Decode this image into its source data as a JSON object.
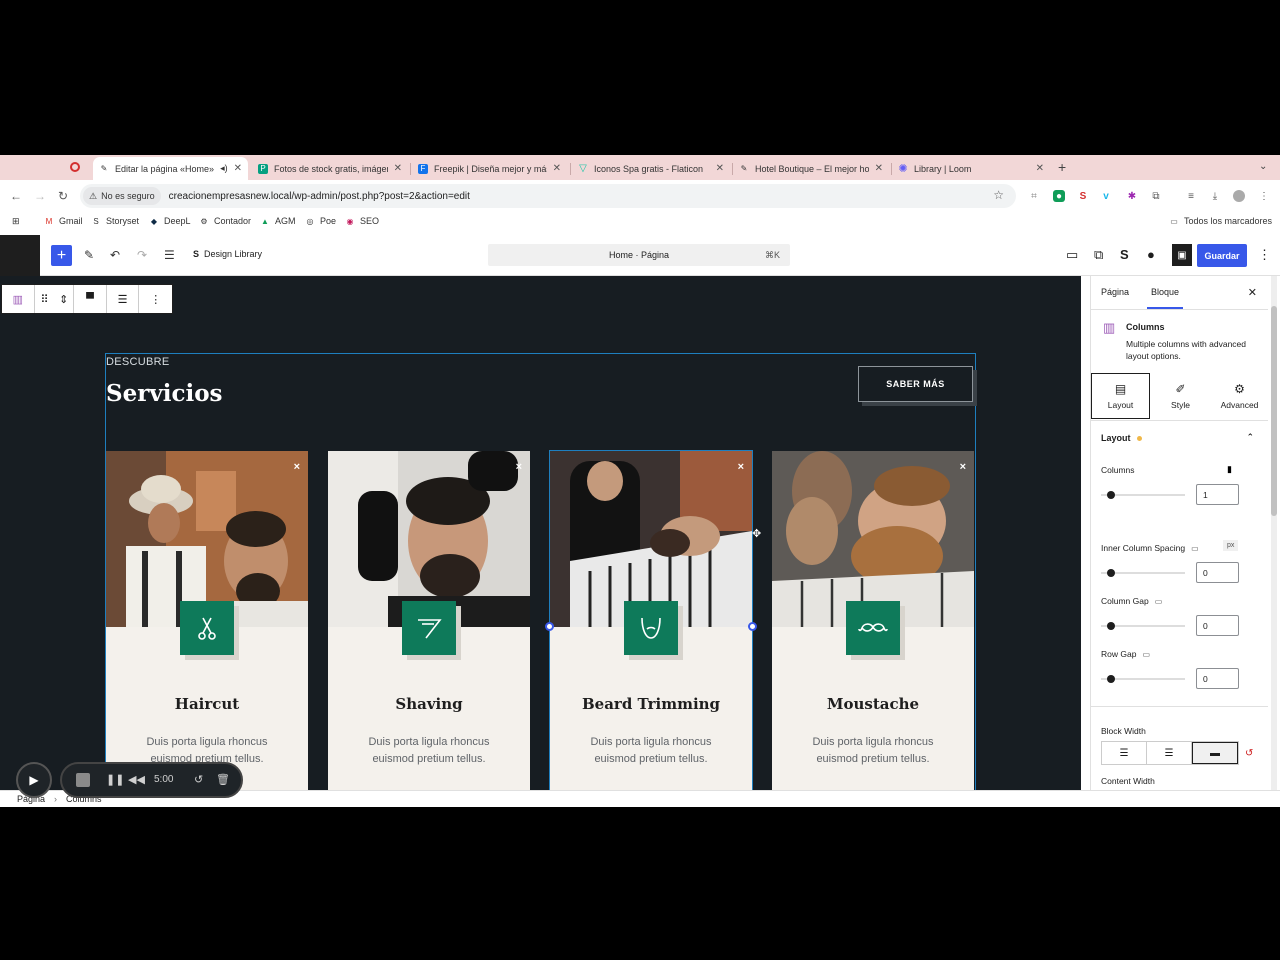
{
  "tabs": [
    {
      "label": "Editar la página «Home»",
      "active": true,
      "icon": "wordpress-icon"
    },
    {
      "label": "Fotos de stock gratis, imágen",
      "icon": "pexels-icon"
    },
    {
      "label": "Freepik | Diseña mejor y más",
      "icon": "freepik-icon"
    },
    {
      "label": "Iconos Spa gratis - Flaticon",
      "icon": "flaticon-icon"
    },
    {
      "label": "Hotel Boutique – El mejor hot",
      "icon": "wordpress-icon"
    },
    {
      "label": "Library | Loom",
      "icon": "loom-icon"
    }
  ],
  "address": {
    "security": "No es seguro",
    "url": "creacionempresasnew.local/wp-admin/post.php?post=2&action=edit"
  },
  "bookmarks": [
    {
      "label": "Gmail"
    },
    {
      "label": "Storyset"
    },
    {
      "label": "DeepL"
    },
    {
      "label": "Contador"
    },
    {
      "label": "AGM"
    },
    {
      "label": "Poe"
    },
    {
      "label": "SEO"
    }
  ],
  "bookmarks_right": "Todos los marcadores",
  "toolbar": {
    "design_library": "Design Library",
    "command": "Home · Página",
    "shortcut": "⌘K",
    "save": "Guardar"
  },
  "section": {
    "eyebrow": "DESCUBRE",
    "title": "Servicios",
    "cta": "SABER MÁS",
    "remove_glyph": "×"
  },
  "cards": [
    {
      "title": "Haircut",
      "desc": "Duis porta ligula rhoncus euismod pretium tellus.",
      "icon": "scissors-icon"
    },
    {
      "title": "Shaving",
      "desc": "Duis porta ligula rhoncus euismod pretium tellus.",
      "icon": "razor-icon"
    },
    {
      "title": "Beard Trimming",
      "desc": "Duis porta ligula rhoncus euismod pretium tellus.",
      "icon": "beard-icon"
    },
    {
      "title": "Moustache",
      "desc": "Duis porta ligula rhoncus euismod pretium tellus.",
      "icon": "moustache-icon"
    }
  ],
  "sidebar": {
    "tab_page": "Página",
    "tab_block": "Bloque",
    "block_name": "Columns",
    "block_desc": "Multiple columns with advanced layout options.",
    "subtabs": [
      "Layout",
      "Style",
      "Advanced"
    ],
    "section": "Layout",
    "columns_label": "Columns",
    "columns_value": "1",
    "inner_spacing_label": "Inner Column Spacing",
    "inner_spacing_unit": "px",
    "inner_spacing_value": "0",
    "column_gap_label": "Column Gap",
    "column_gap_value": "0",
    "row_gap_label": "Row Gap",
    "row_gap_value": "0",
    "block_width_label": "Block Width",
    "content_width_label": "Content Width"
  },
  "breadcrumb": [
    "Página",
    "Columns"
  ],
  "loom": {
    "timer": "5:00"
  },
  "colors": {
    "accent": "#3858e9",
    "brand_green": "#0e7a5a",
    "canvas": "#171d22"
  }
}
